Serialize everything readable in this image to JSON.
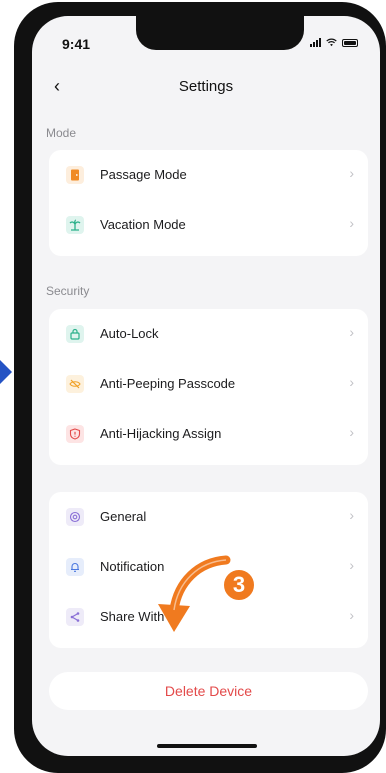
{
  "status_bar": {
    "time": "9:41"
  },
  "nav": {
    "title": "Settings"
  },
  "sections": {
    "mode_label": "Mode",
    "security_label": "Security"
  },
  "mode_items": [
    {
      "label": "Passage Mode",
      "icon": "door-icon",
      "color": "#f08a24"
    },
    {
      "label": "Vacation Mode",
      "icon": "palm-tree-icon",
      "color": "#2bb08a"
    }
  ],
  "security_items": [
    {
      "label": "Auto-Lock",
      "icon": "lock-icon",
      "color": "#2bb08a"
    },
    {
      "label": "Anti-Peeping Passcode",
      "icon": "eye-off-icon",
      "color": "#f0a024"
    },
    {
      "label": "Anti-Hijacking Assign",
      "icon": "shield-alert-icon",
      "color": "#e34a4a"
    }
  ],
  "other_items": [
    {
      "label": "General",
      "icon": "settings-icon",
      "color": "#8a6fd6"
    },
    {
      "label": "Notification",
      "icon": "bell-icon",
      "color": "#4a78e0"
    },
    {
      "label": "Share With",
      "icon": "share-icon",
      "color": "#8a6fd6"
    }
  ],
  "delete_label": "Delete Device",
  "annotation": {
    "step": "3",
    "color": "#f07a1f"
  }
}
